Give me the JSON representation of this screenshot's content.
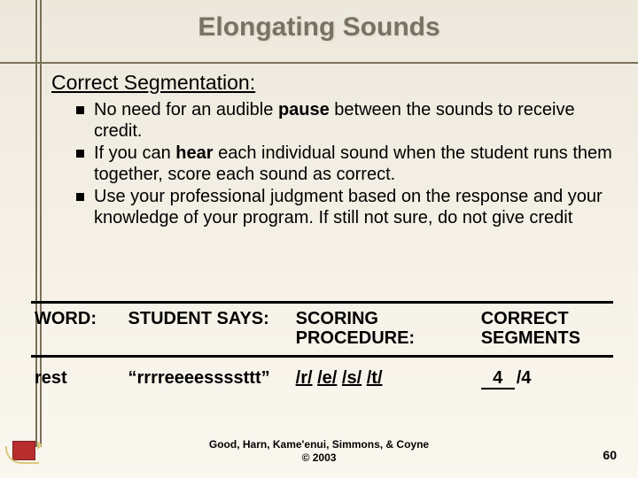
{
  "title": "Elongating Sounds",
  "subheading": "Correct Segmentation:",
  "bullets": [
    {
      "pre": "No need for an audible ",
      "bold": "pause",
      "post": " between the sounds to receive credit."
    },
    {
      "pre": "If you can ",
      "bold": "hear",
      "post": " each individual sound when the student runs them together, score each sound as correct."
    },
    {
      "pre": "Use your professional judgment based on the response and your knowledge of your program. If still not sure, do not give credit",
      "bold": "",
      "post": ""
    }
  ],
  "table": {
    "headers": {
      "word": "WORD:",
      "says": "STUDENT SAYS:",
      "scoring": "SCORING PROCEDURE:",
      "correct": "CORRECT SEGMENTS"
    },
    "row": {
      "word": "rest",
      "says": "“rrrreeeessssttt”",
      "scoring_segments": [
        "/r/",
        "/e/",
        "/s/",
        "/t/"
      ],
      "correct_num": "4",
      "correct_denom": "/4"
    }
  },
  "footer": {
    "line1": "Good, Harn, Kame'enui, Simmons, & Coyne",
    "line2": "© 2003"
  },
  "page": "60"
}
